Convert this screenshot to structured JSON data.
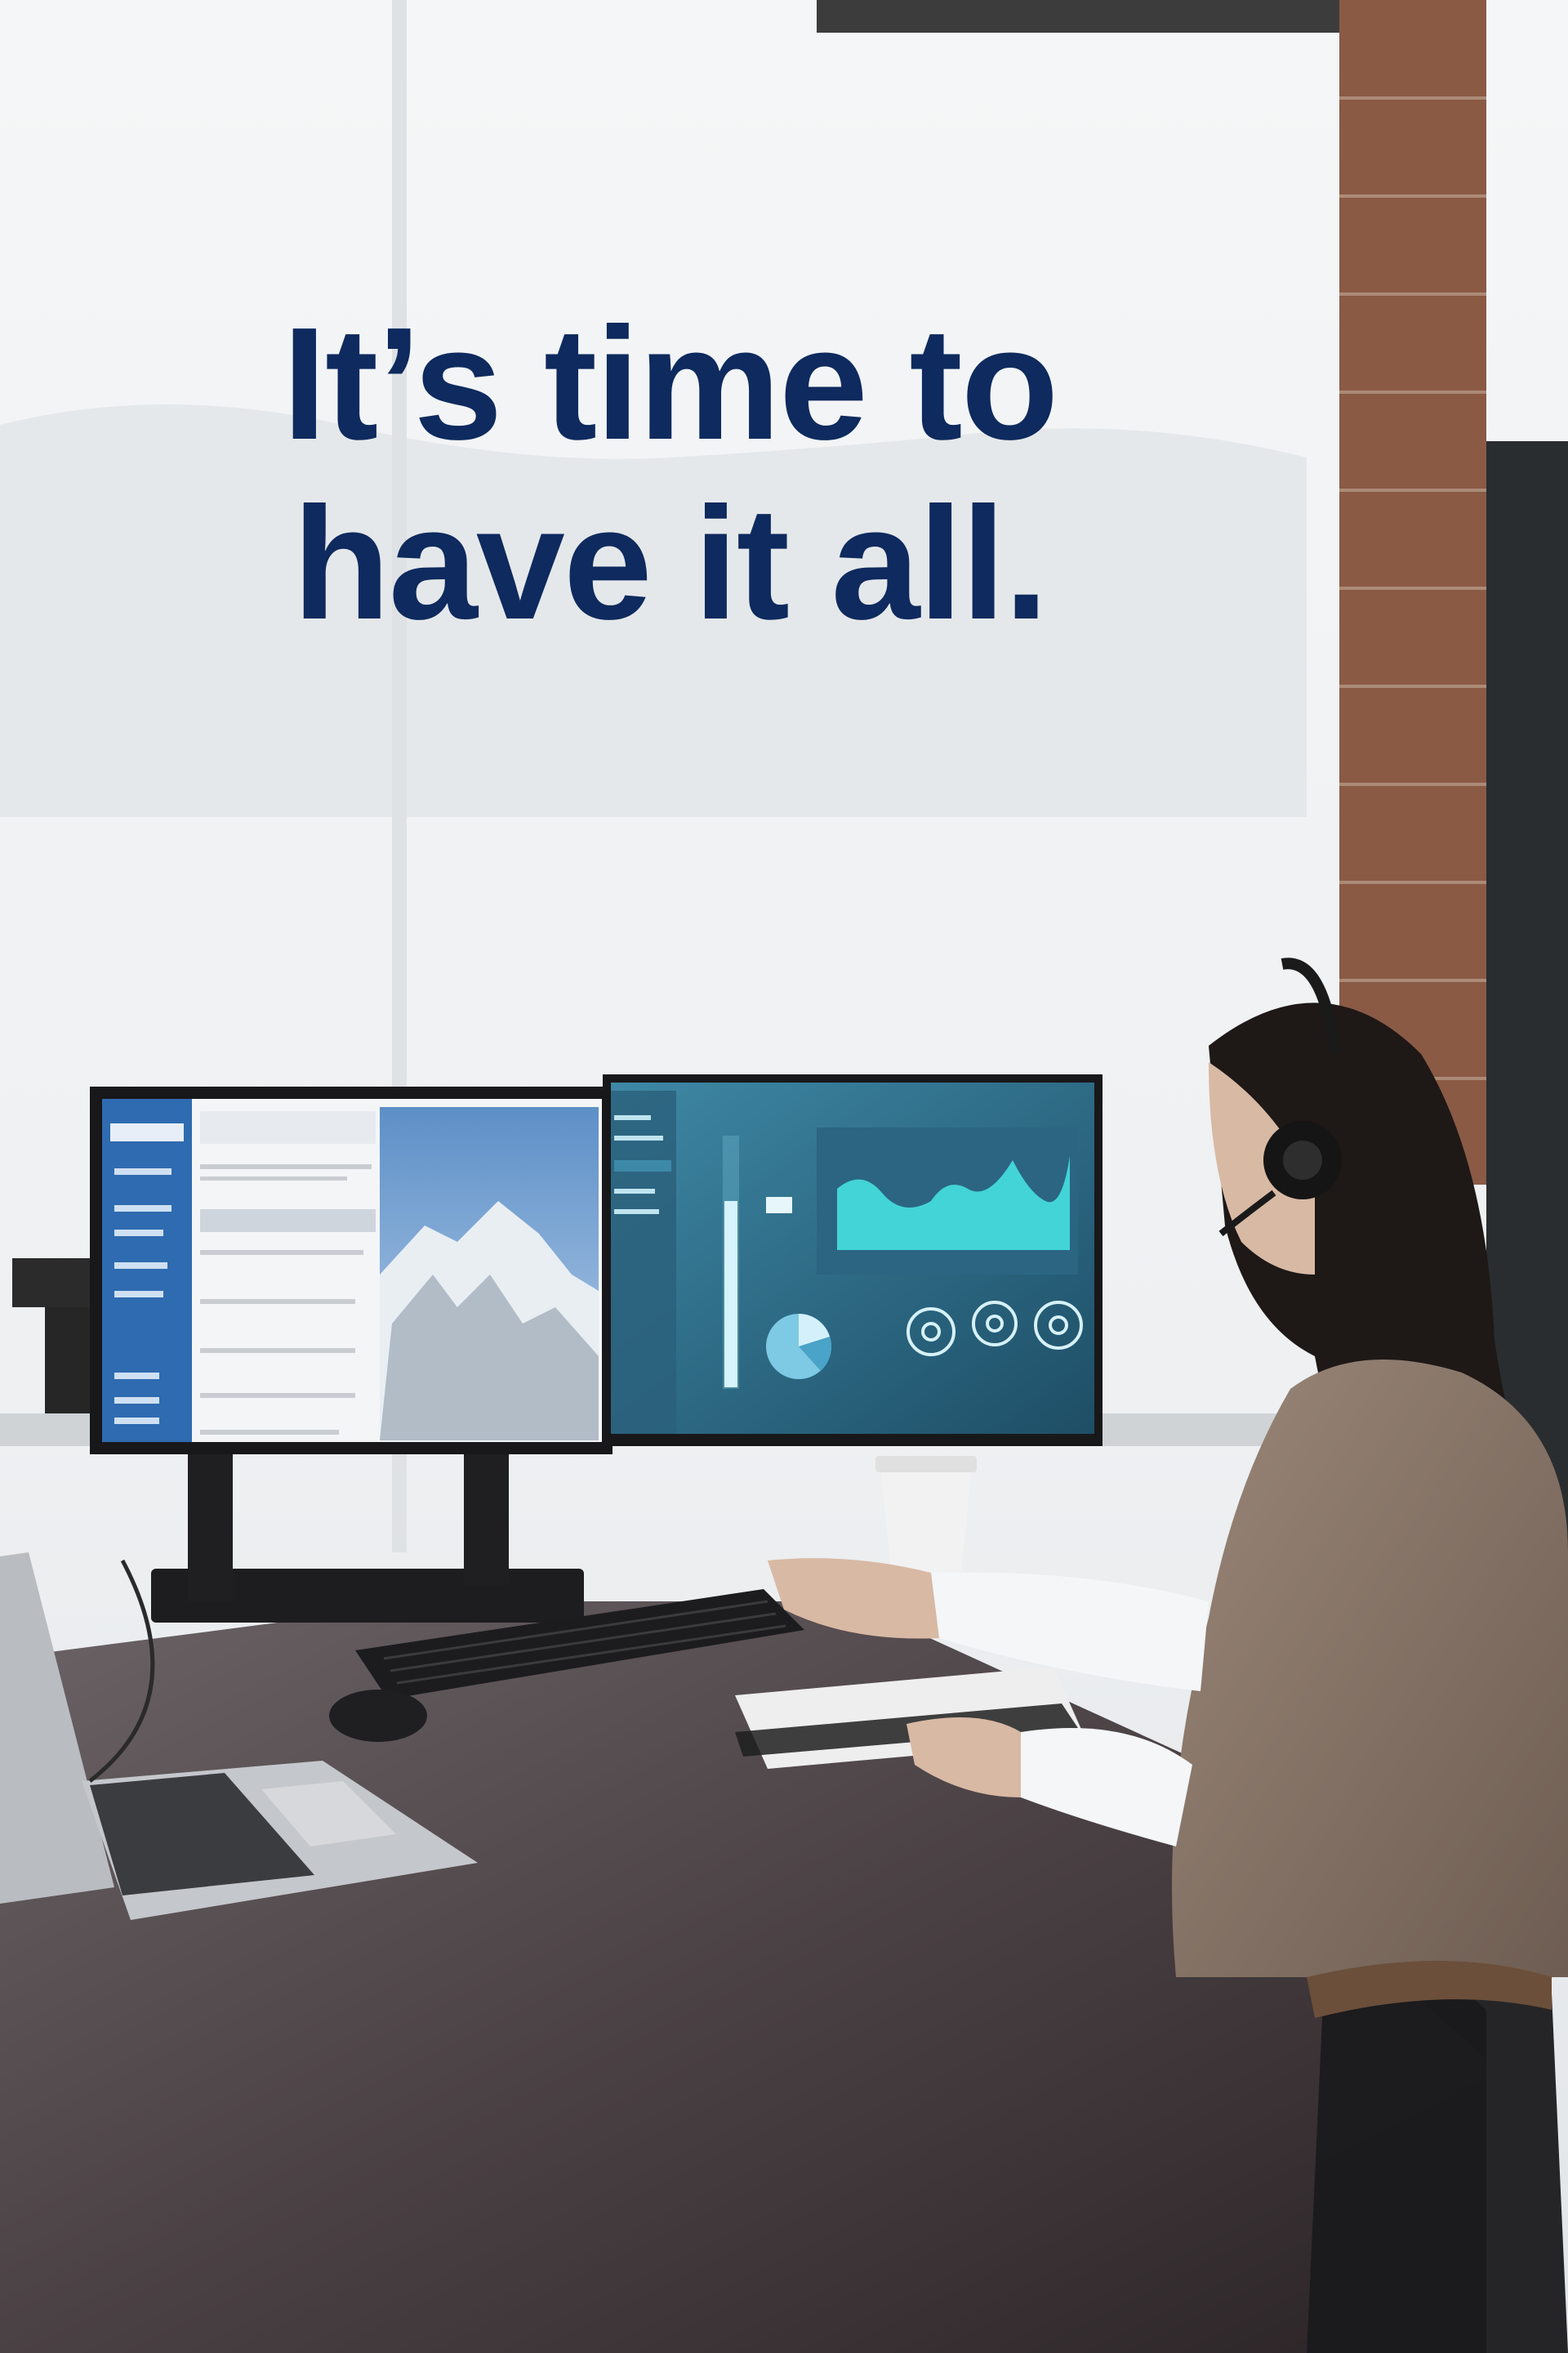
{
  "headline": {
    "line1": "It’s time to",
    "line2": "have it all."
  },
  "colors": {
    "headline": "#0e2a5e",
    "window_light": "#f2f4f5",
    "brick": "#8a5a45",
    "desk": "#3d3436",
    "screen_right": "#2e6d8a",
    "chart_area": "#45e0e0",
    "sidebar_blue": "#2f6bb0"
  },
  "scene": {
    "description_icons": [
      "window-blinds",
      "brick-wall",
      "dual-monitor",
      "laptop",
      "keyboard",
      "mouse",
      "coffee-cup",
      "notebook",
      "person-with-headset"
    ]
  }
}
